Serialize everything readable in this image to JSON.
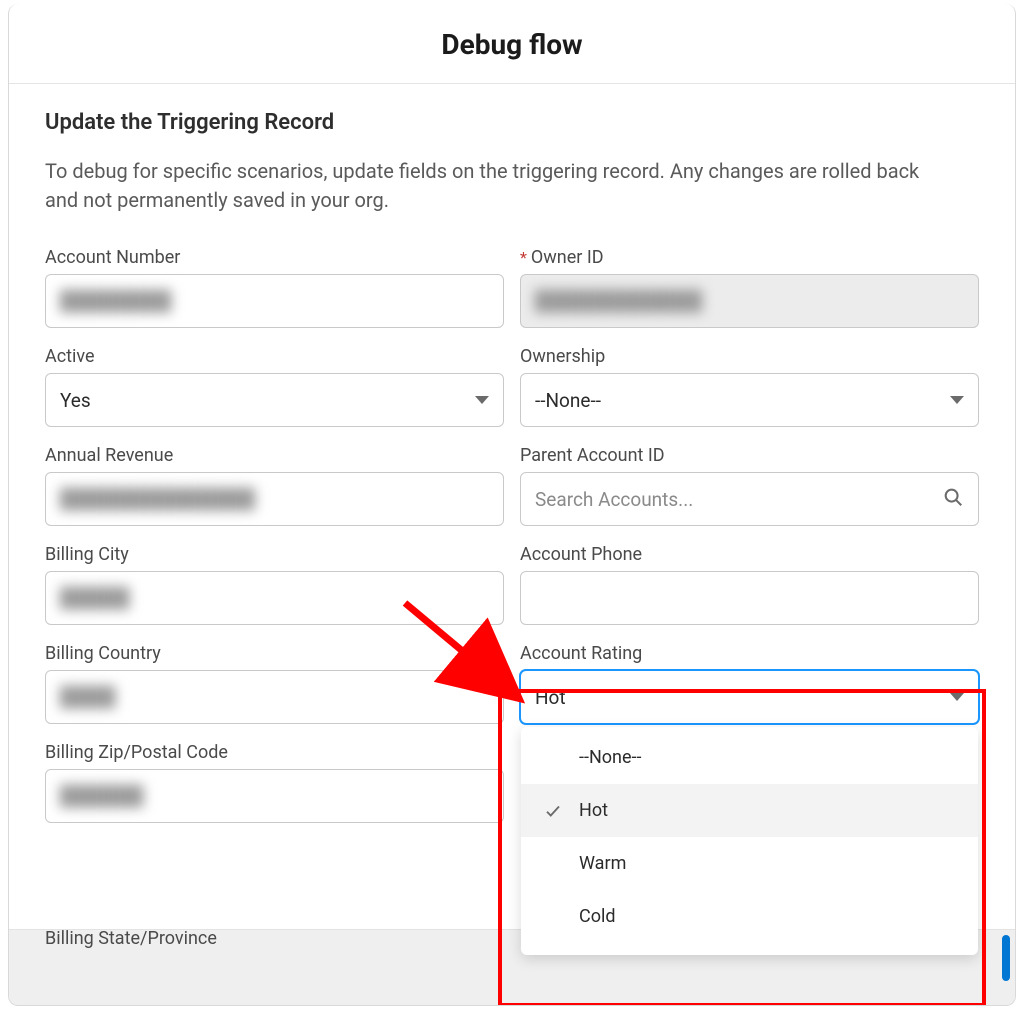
{
  "header": {
    "title": "Debug flow"
  },
  "section": {
    "title": "Update the Triggering Record",
    "description": "To debug for specific scenarios, update fields on the triggering record. Any changes are rolled back and not permanently saved in your org."
  },
  "fields": {
    "account_number": {
      "label": "Account Number",
      "value_masked": "████████"
    },
    "owner_id": {
      "label": "Owner ID",
      "required_marker": "*",
      "value_masked": "████████████"
    },
    "active": {
      "label": "Active",
      "value": "Yes"
    },
    "ownership": {
      "label": "Ownership",
      "value": "--None--"
    },
    "annual_revenue": {
      "label": "Annual Revenue",
      "value_masked": "██████████████"
    },
    "parent_account": {
      "label": "Parent Account ID",
      "placeholder": "Search Accounts..."
    },
    "billing_city": {
      "label": "Billing City",
      "value_masked": "█████"
    },
    "account_phone": {
      "label": "Account Phone",
      "value": ""
    },
    "billing_country": {
      "label": "Billing Country",
      "value_masked": "████"
    },
    "account_rating": {
      "label": "Account Rating",
      "value": "Hot",
      "options": [
        "--None--",
        "Hot",
        "Warm",
        "Cold"
      ],
      "selected_index": 1
    },
    "billing_zip": {
      "label": "Billing Zip/Postal Code",
      "value_masked": "██████"
    },
    "billing_state_partial": {
      "label": "Billing State/Province"
    }
  }
}
